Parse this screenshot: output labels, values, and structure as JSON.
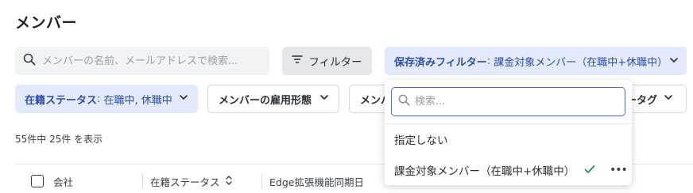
{
  "page": {
    "title": "メンバー"
  },
  "search": {
    "placeholder": "メンバーの名前、メールアドレスで検索..."
  },
  "filter_button": {
    "label": "フィルター"
  },
  "saved_filter": {
    "label": "保存済みフィルター",
    "separator": ": ",
    "value": "課金対象メンバー（在職中+休職中）"
  },
  "chips": {
    "status": {
      "label": "在籍ステータス",
      "separator": ": ",
      "value": "在職中, 休職中"
    },
    "employment": {
      "label": "メンバーの雇用形態"
    },
    "member_partial": {
      "label": "メンバ"
    },
    "tag_partial": {
      "label": "ータグ"
    }
  },
  "result_count": "55件中 25件 を表示",
  "table": {
    "columns": [
      "会社",
      "在籍ステータス",
      "Edge拡張機能同期日"
    ]
  },
  "dropdown": {
    "search_placeholder": "検索...",
    "items": [
      {
        "label": "指定しない",
        "selected": false
      },
      {
        "label": "課金対象メンバー（在職中+休職中）",
        "selected": true
      }
    ]
  },
  "colors": {
    "accent_blue": "#2b4ea8",
    "accent_bg": "#e3eafb",
    "check_green": "#2e8b57"
  }
}
